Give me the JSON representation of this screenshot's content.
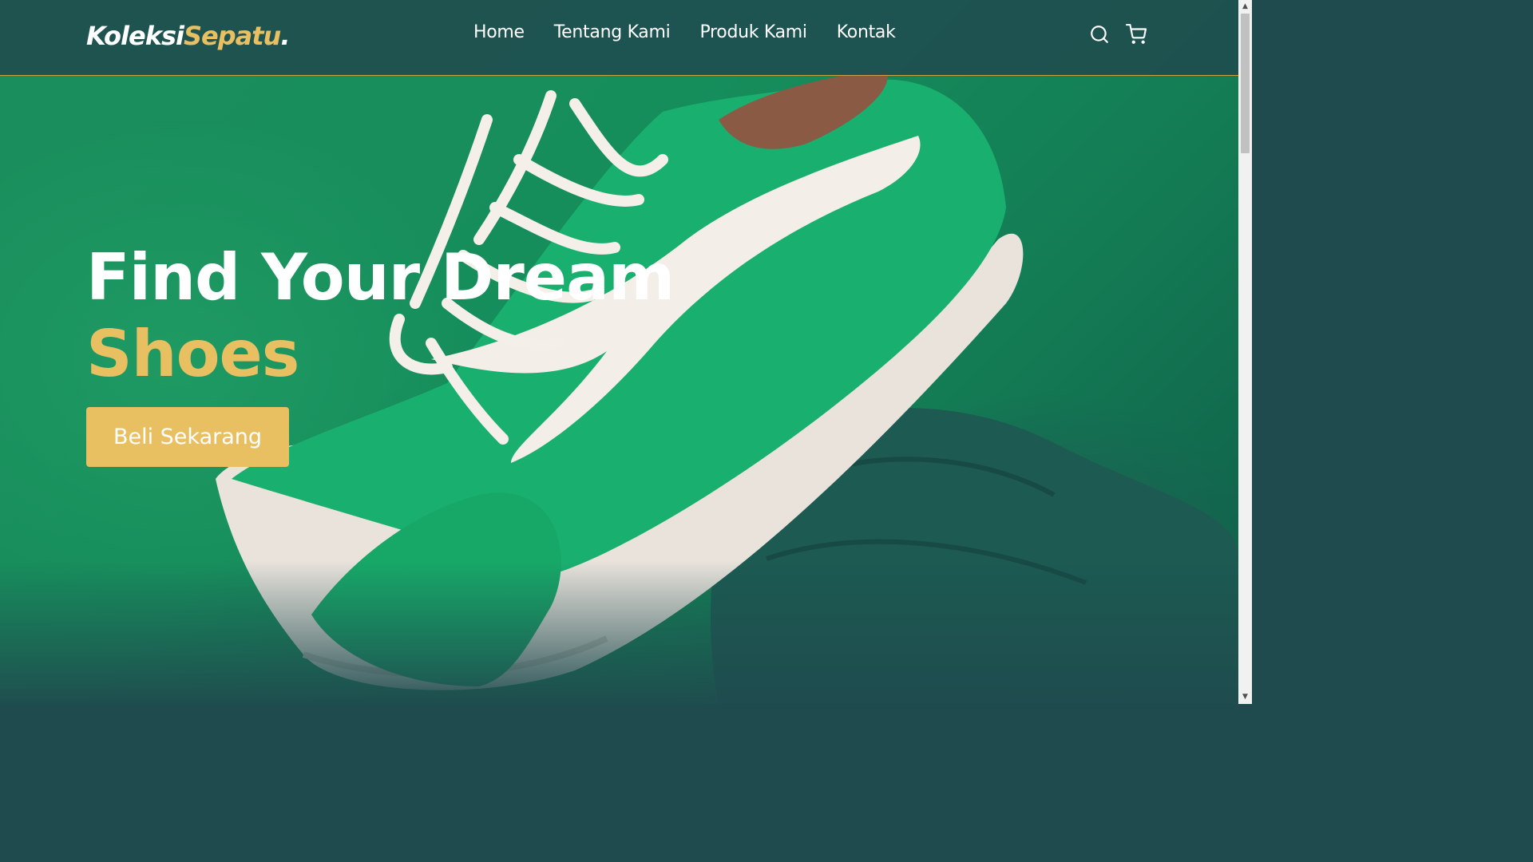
{
  "logo": {
    "main": "Koleksi",
    "accent": "Sepatu",
    "dot": "."
  },
  "nav": {
    "links": [
      "Home",
      "Tentang Kami",
      "Produk Kami",
      "Kontak"
    ]
  },
  "icons": {
    "search": "search-icon",
    "cart": "shopping-cart-icon"
  },
  "hero": {
    "headline_line1": "Find Your Dream",
    "headline_line2": "Shoes",
    "cta_label": "Beli Sekarang"
  },
  "colors": {
    "navbar": "#1f4b4e",
    "accent": "#e8c062",
    "hero_green": "#168e5c",
    "text": "#ffffff"
  }
}
